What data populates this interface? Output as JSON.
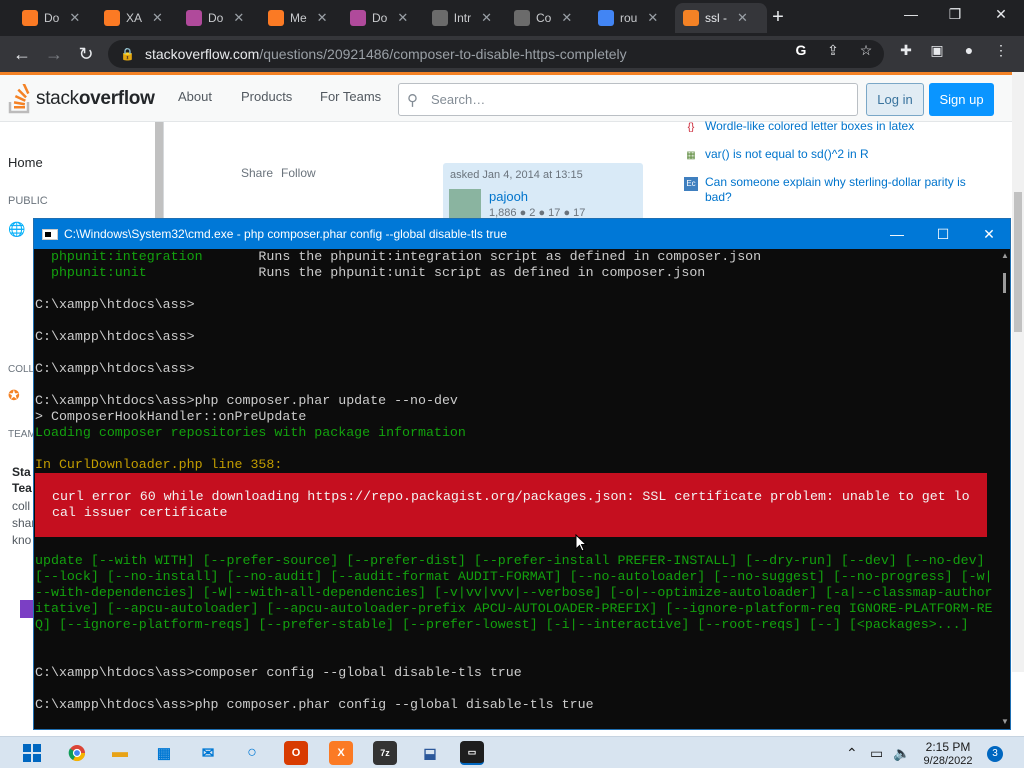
{
  "browser": {
    "tabs": [
      {
        "label": "Do",
        "icon": "xampp-icon",
        "color": "#fb7a24"
      },
      {
        "label": "XA",
        "icon": "xampp-icon",
        "color": "#fb7a24"
      },
      {
        "label": "Do",
        "icon": "composer-icon",
        "color": "#b04a9b"
      },
      {
        "label": "Me",
        "icon": "xampp-icon",
        "color": "#fb7a24"
      },
      {
        "label": "Do",
        "icon": "composer-icon",
        "color": "#b04a9b"
      },
      {
        "label": "Intr",
        "icon": "composer-logo-icon",
        "color": "#6b6b6b"
      },
      {
        "label": "Co",
        "icon": "composer-logo-icon",
        "color": "#6b6b6b"
      },
      {
        "label": "rou",
        "icon": "google-icon",
        "color": "#4285f4"
      },
      {
        "label": "ssl -",
        "icon": "stackoverflow-icon",
        "color": "#f48225"
      }
    ],
    "url_host": "stackoverflow.com",
    "url_path": "/questions/20921486/composer-to-disable-https-completely"
  },
  "so": {
    "logo_text_1": "stack",
    "logo_text_2": "overflow",
    "nav": [
      "About",
      "Products",
      "For Teams"
    ],
    "search_placeholder": "Search…",
    "login": "Log in",
    "signup": "Sign up",
    "left": {
      "home": "Home",
      "public": "PUBLIC",
      "colle": "COLL",
      "team": "TEAM"
    },
    "share": "Share",
    "follow": "Follow",
    "asked": "asked Jan 4, 2014 at 13:15",
    "user": "pajooh",
    "rep": "1,886 ● 2 ● 17 ● 17",
    "related": [
      "Wordle-like colored letter boxes in latex",
      "var() is not equal to sd()^2 in R",
      "Can someone explain why sterling-dollar parity is bad?"
    ],
    "left_frag": [
      "Sta",
      "Tea",
      "coll",
      "shar",
      "kno"
    ]
  },
  "cmd": {
    "title": "C:\\Windows\\System32\\cmd.exe - php  composer.phar config --global disable-tls true",
    "lines": [
      {
        "text": "  phpunit:integration       Runs the phpunit:integration script as defined in composer.json",
        "color": "mix1"
      },
      {
        "text": "  phpunit:unit              Runs the phpunit:unit script as defined in composer.json",
        "color": "mix2"
      },
      {
        "text": "",
        "color": "w"
      },
      {
        "text": "C:\\xampp\\htdocs\\ass>",
        "color": "w"
      },
      {
        "text": "",
        "color": "w"
      },
      {
        "text": "C:\\xampp\\htdocs\\ass>",
        "color": "w"
      },
      {
        "text": "",
        "color": "w"
      },
      {
        "text": "C:\\xampp\\htdocs\\ass>",
        "color": "w"
      },
      {
        "text": "",
        "color": "w"
      },
      {
        "text": "C:\\xampp\\htdocs\\ass>php composer.phar update --no-dev",
        "color": "w"
      },
      {
        "text": "> ComposerHookHandler::onPreUpdate",
        "color": "w"
      },
      {
        "text": "Loading composer repositories with package information",
        "color": "g"
      },
      {
        "text": "",
        "color": "w"
      },
      {
        "text": "In CurlDownloader.php line 358:",
        "color": "y"
      }
    ],
    "error_lines": [
      "  curl error 60 while downloading https://repo.packagist.org/packages.json: SSL certificate problem: unable to get lo",
      "  cal issuer certificate"
    ],
    "usage_lines": [
      "update [--with WITH] [--prefer-source] [--prefer-dist] [--prefer-install PREFER-INSTALL] [--dry-run] [--dev] [--no-dev]",
      "[--lock] [--no-install] [--no-audit] [--audit-format AUDIT-FORMAT] [--no-autoloader] [--no-suggest] [--no-progress] [-w|",
      "--with-dependencies] [-W|--with-all-dependencies] [-v|vv|vvv|--verbose] [-o|--optimize-autoloader] [-a|--classmap-author",
      "itative] [--apcu-autoloader] [--apcu-autoloader-prefix APCU-AUTOLOADER-PREFIX] [--ignore-platform-req IGNORE-PLATFORM-RE",
      "Q] [--ignore-platform-reqs] [--prefer-stable] [--prefer-lowest] [-i|--interactive] [--root-reqs] [--] [<packages>...]"
    ],
    "tail_lines": [
      "C:\\xampp\\htdocs\\ass>composer config --global disable-tls true",
      "",
      "C:\\xampp\\htdocs\\ass>php composer.phar config --global disable-tls true"
    ]
  },
  "taskbar": {
    "time": "2:15 PM",
    "date": "9/28/2022",
    "notifications": "3"
  }
}
